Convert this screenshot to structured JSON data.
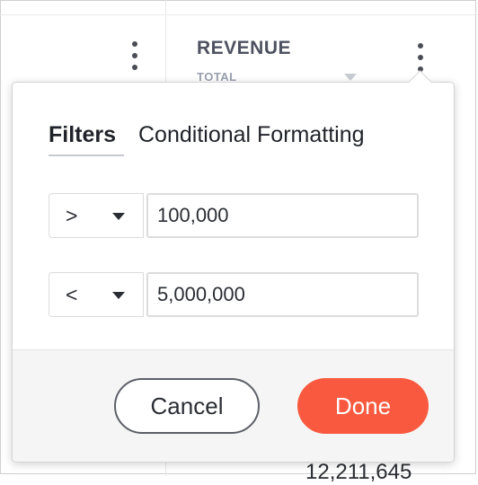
{
  "table": {
    "column_header": "REVENUE",
    "column_subheader": "TOTAL",
    "visible_cell_value": "12,211,645"
  },
  "popover": {
    "tabs": [
      {
        "label": "Filters",
        "active": true
      },
      {
        "label": "Conditional Formatting",
        "active": false
      }
    ],
    "filters": [
      {
        "operator": ">",
        "value": "100,000"
      },
      {
        "operator": "<",
        "value": "5,000,000"
      }
    ],
    "cancel_label": "Cancel",
    "done_label": "Done"
  },
  "colors": {
    "accent": "#f95a3f",
    "header_text": "#4e5260",
    "subheader_text": "#9aa0ae"
  }
}
